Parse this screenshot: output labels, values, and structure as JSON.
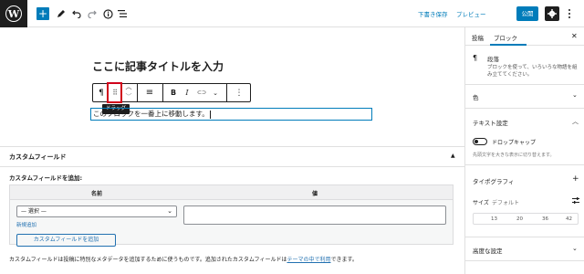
{
  "toolbar": {
    "logo_letter": "W",
    "add_label": "+",
    "save_draft": "下書き保存",
    "preview": "プレビュー",
    "publish": "公開"
  },
  "editor": {
    "title": "ここに記事タイトルを入力",
    "block_toolbar": {
      "paragraph_icon": "¶",
      "drag_icon": "⠿",
      "move_up": "︿",
      "move_down": "﹀",
      "align_icon": "≡",
      "bold": "B",
      "italic": "I",
      "link_icon": "⊂⊃",
      "chevron": "⌄",
      "more": "⋮"
    },
    "drag_tooltip": "ドラッグ",
    "paragraph_text": "このブロックを一番上に移動します。"
  },
  "custom_fields": {
    "title": "カスタムフィールド",
    "toggle": "▲",
    "add_label": "カスタムフィールドを追加:",
    "col_name": "名前",
    "col_value": "値",
    "select_value": "— 選択 —",
    "select_arrow": "⌄",
    "new_link": "新規追加",
    "add_button": "カスタムフィールドを追加",
    "note_before": "カスタムフィールドは投稿に特別なメタデータを追加するために使うものです。追加されたカスタムフィールドは",
    "note_link": "テーマの中で利用",
    "note_after": "できます。"
  },
  "sidebar": {
    "tab_post": "投稿",
    "tab_block": "ブロック",
    "close": "✕",
    "block_icon": "¶",
    "block_name": "段落",
    "block_description": "ブロックを使って、いろいろな物語を組み立ててください。",
    "color_panel": "色",
    "text_settings": "テキスト設定",
    "drop_cap": "ドロップキャップ",
    "drop_cap_help": "先頭文字を大きな表示に切り替えます。",
    "typography": "タイポグラフィ",
    "typography_add": "+",
    "size_label": "サイズ",
    "size_default": "デフォルト",
    "font_sizes": [
      "13",
      "20",
      "36",
      "42"
    ],
    "advanced": "高度な設定"
  }
}
